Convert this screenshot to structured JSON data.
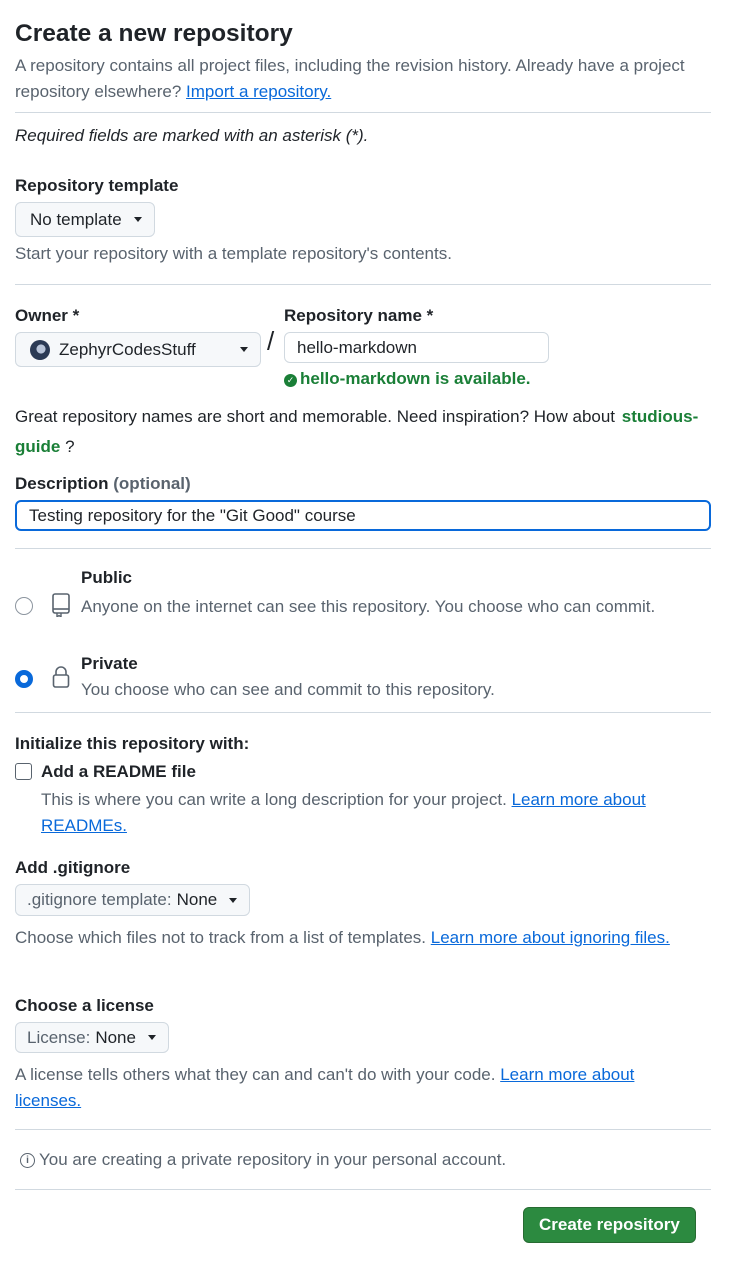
{
  "header": {
    "title": "Create a new repository",
    "intro_text": "A repository contains all project files, including the revision history. Already have a project repository elsewhere?",
    "import_link": "Import a repository."
  },
  "required_note": "Required fields are marked with an asterisk (*).",
  "template": {
    "label": "Repository template",
    "selected": "No template",
    "help": "Start your repository with a template repository's contents."
  },
  "owner": {
    "label": "Owner *",
    "selected": "ZephyrCodesStuff"
  },
  "slash": "/",
  "repo_name": {
    "label": "Repository name *",
    "value": "hello-markdown",
    "availability": "hello-markdown is available."
  },
  "suggestion": {
    "text_before": "Great repository names are short and memorable. Need inspiration? How about",
    "name": "studious-guide",
    "text_after": "?"
  },
  "description": {
    "label": "Description",
    "optional": "(optional)",
    "value": "Testing repository for the \"Git Good\" course"
  },
  "visibility": {
    "public": {
      "label": "Public",
      "description": "Anyone on the internet can see this repository. You choose who can commit.",
      "selected": false
    },
    "private": {
      "label": "Private",
      "description": "You choose who can see and commit to this repository.",
      "selected": true
    }
  },
  "initialize": {
    "heading": "Initialize this repository with:",
    "readme": {
      "label": "Add a README file",
      "checked": false,
      "description": "This is where you can write a long description for your project.",
      "link": "Learn more about READMEs."
    }
  },
  "gitignore": {
    "label": "Add .gitignore",
    "select_prefix": ".gitignore template:",
    "select_value": "None",
    "help": "Choose which files not to track from a list of templates.",
    "link": "Learn more about ignoring files."
  },
  "license": {
    "label": "Choose a license",
    "select_prefix": "License:",
    "select_value": "None",
    "help": "A license tells others what they can and can't do with your code.",
    "link": "Learn more about licenses."
  },
  "info_note": "You are creating a private repository in your personal account.",
  "submit_button": "Create repository",
  "colors": {
    "accent": "#0969da",
    "success": "#1a7f37",
    "primary_button": "#2c8a40"
  }
}
